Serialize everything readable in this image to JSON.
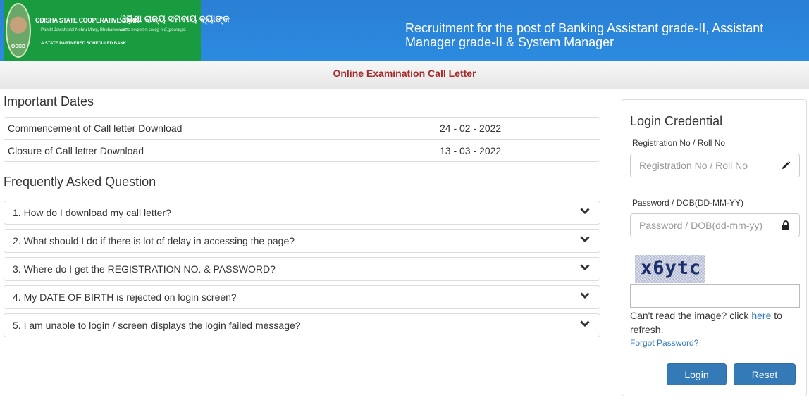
{
  "header": {
    "logo": {
      "bank_name": "ODISHA STATE COOPERATIVE BANK",
      "bank_name_odia": "ଓଡ଼ିଶା ରାଜ୍ୟ ସମବାୟ ବ୍ୟାଙ୍କ",
      "address": "Pandit Jawaharlal Nehru Marg, Bhubaneswar",
      "address_odia": "ପଣ୍ଡିତ ଜବାହରଲାଲ ନେହେରୁ ମାର୍ଗ, ଭୁବନେଶ୍ୱର",
      "tagline": "A STATE PARTNERED SCHEDULED BANK",
      "emblem_text": "OSCB"
    },
    "title": "Recruitment for the post of Banking Assistant grade-II, Assistant Manager grade-II & System Manager"
  },
  "subheader": {
    "title": "Online Examination Call Letter"
  },
  "important_dates": {
    "title": "Important Dates",
    "rows": [
      {
        "label": "Commencement of Call letter Download",
        "value": "24 - 02 - 2022"
      },
      {
        "label": "Closure of Call letter Download",
        "value": "13 - 03 - 2022"
      }
    ]
  },
  "faq": {
    "title": "Frequently Asked Question",
    "items": [
      {
        "question": "1. How do I download my call letter?"
      },
      {
        "question": "2. What should I do if there is lot of delay in accessing the page?"
      },
      {
        "question": "3. Where do I get the REGISTRATION NO. & PASSWORD?"
      },
      {
        "question": "4. My DATE OF BIRTH is rejected on login screen?"
      },
      {
        "question": "5. I am unable to login / screen displays the login failed message?"
      }
    ],
    "expand_icon": "chevron-down-icon"
  },
  "login": {
    "title": "Login Credential",
    "registration": {
      "label": "Registration No / Roll No",
      "placeholder": "Registration No / Roll No",
      "value": "",
      "icon": "pencil-icon"
    },
    "password": {
      "label": "Password / DOB(DD-MM-YY)",
      "placeholder": "Password / DOB(dd-mm-yy)",
      "value": "",
      "icon": "lock-icon"
    },
    "captcha": {
      "text": "x6ytc",
      "input_value": ""
    },
    "refresh_prefix": "Can't read the image? click ",
    "refresh_link": "here",
    "refresh_suffix": " to refresh.",
    "forgot_password": "Forgot Password?",
    "login_button": "Login",
    "reset_button": "Reset"
  },
  "colors": {
    "header_blue": "#2b87dd",
    "logo_green": "#199c3f",
    "subheader_text": "#a52a2a",
    "primary_button": "#337ab7",
    "link": "#337ab7"
  }
}
